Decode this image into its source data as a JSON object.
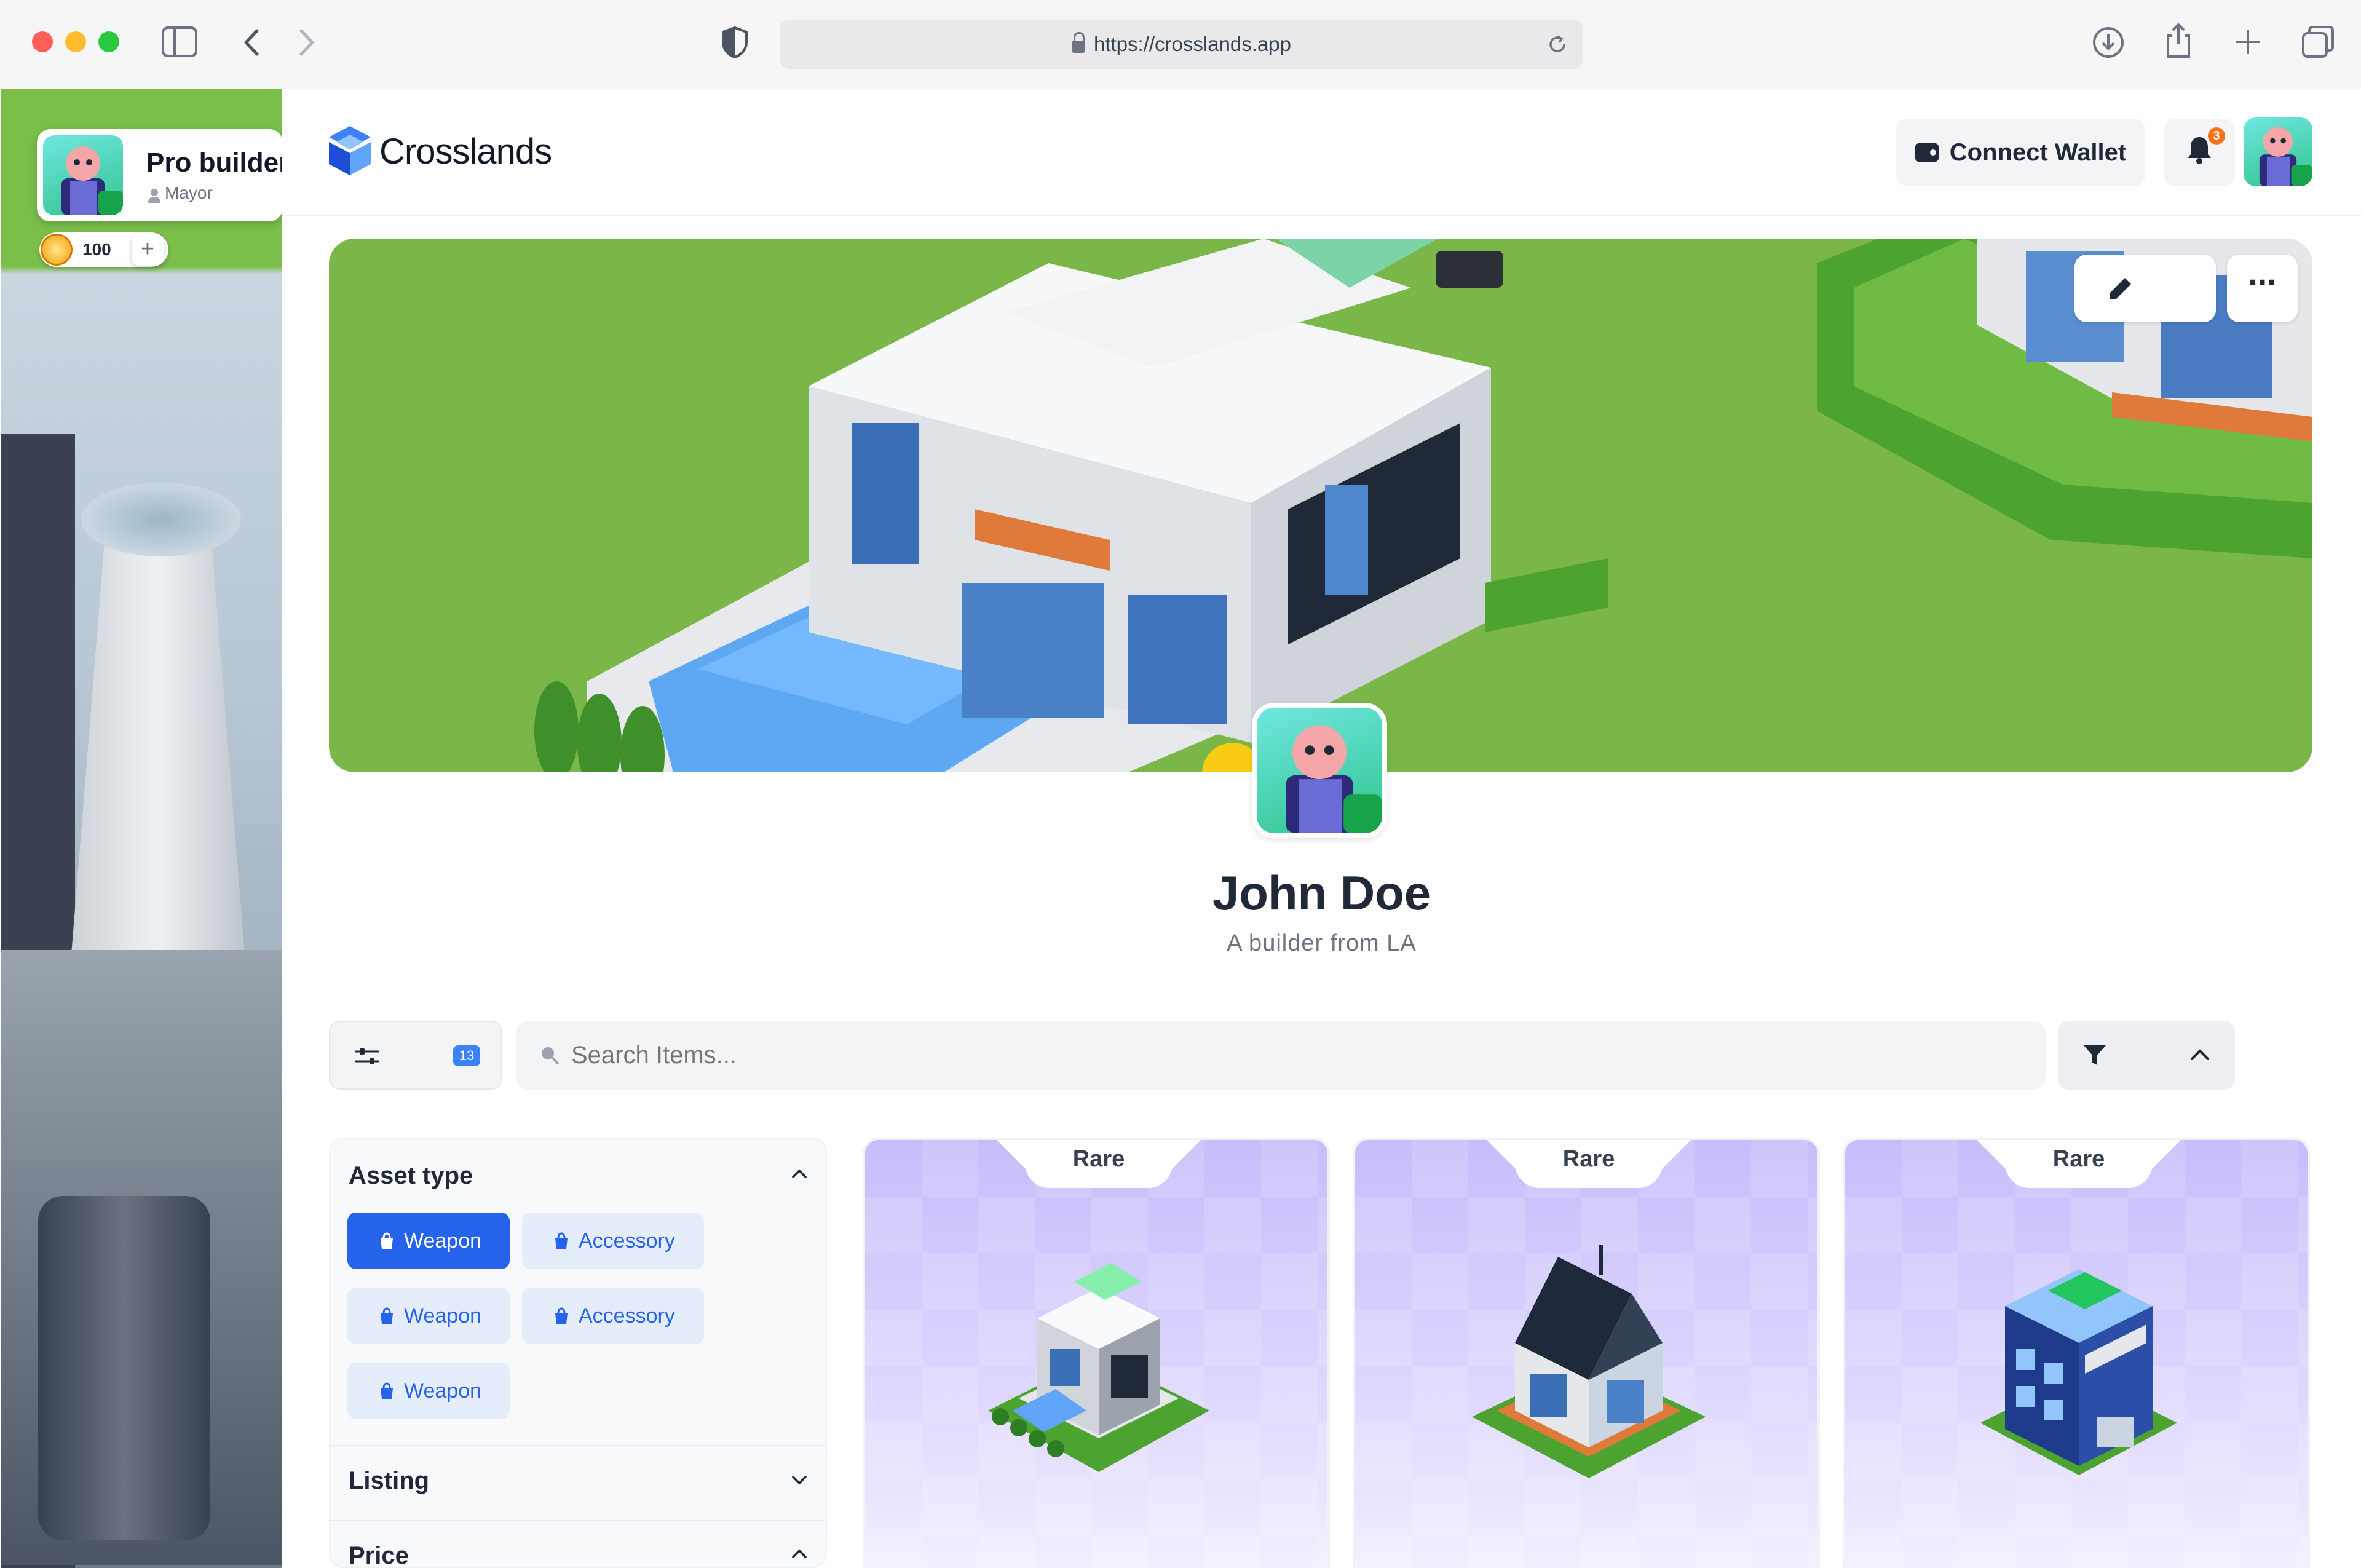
{
  "browser": {
    "url": "https://crosslands.app",
    "icons": [
      "sidebar-icon",
      "back-icon",
      "forward-icon",
      "shield-icon",
      "lock-icon",
      "reload-icon",
      "download-icon",
      "share-icon",
      "new-tab-icon",
      "tabs-icon"
    ]
  },
  "game_hud": {
    "player_name": "Pro builder",
    "role": "Mayor",
    "coins": "100",
    "add_label": "+"
  },
  "header": {
    "brand": "Crosslands",
    "connect_wallet": "Connect Wallet",
    "notification_count": "3"
  },
  "profile": {
    "name": "John Doe",
    "bio": "A builder from LA"
  },
  "toolbar": {
    "filter_count": "13",
    "search_placeholder": "Search Items..."
  },
  "filters": {
    "asset_type": {
      "title": "Asset type",
      "chips": [
        "Weapon",
        "Accessory",
        "Weapon",
        "Accessory",
        "Weapon"
      ],
      "selected": "Weapon"
    },
    "listing": {
      "title": "Listing"
    },
    "price": {
      "title": "Price"
    }
  },
  "items": [
    {
      "rarity": "Rare",
      "icon": "modern-villa-icon"
    },
    {
      "rarity": "Rare",
      "icon": "cottage-house-icon"
    },
    {
      "rarity": "Rare",
      "icon": "police-station-icon"
    }
  ],
  "colors": {
    "accent": "#2563eb",
    "banner": "#7ab648",
    "card": "#ddd6fe",
    "badge": "#f97316"
  }
}
